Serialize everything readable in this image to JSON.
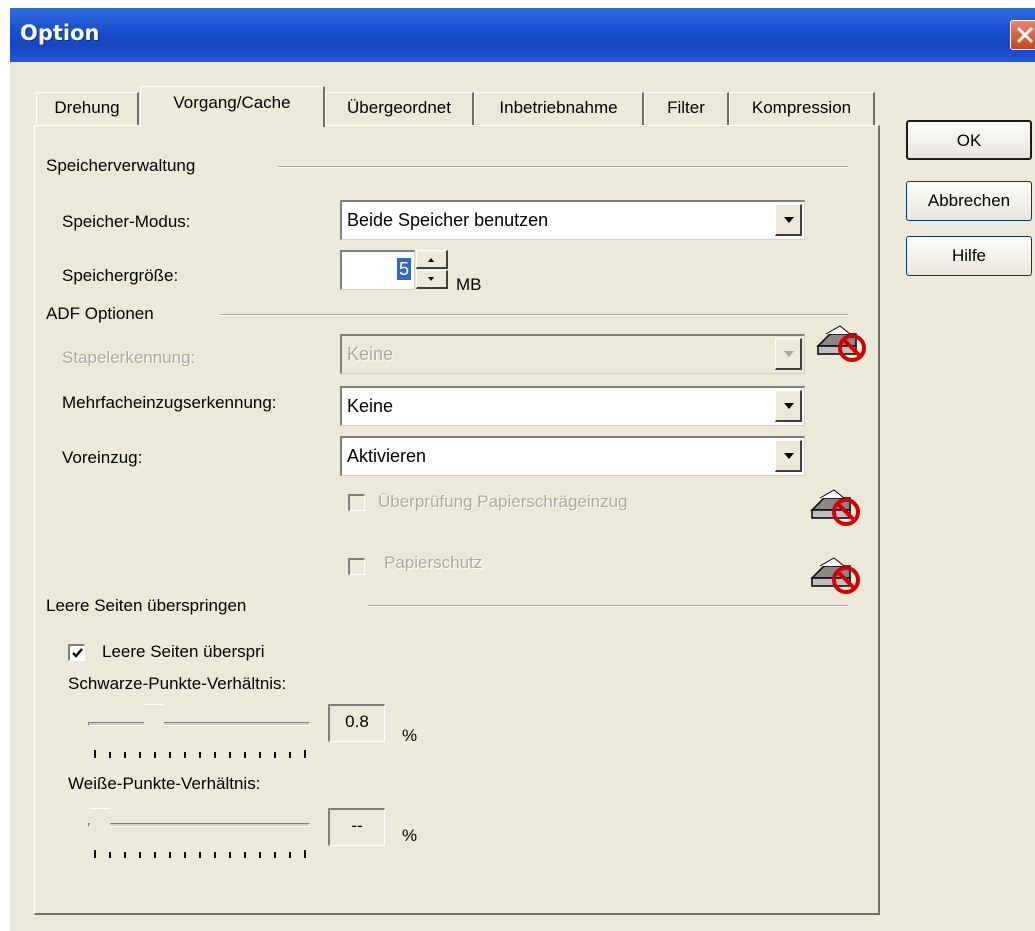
{
  "window": {
    "title": "Option"
  },
  "tabs": [
    {
      "label": "Drehung"
    },
    {
      "label": "Vorgang/Cache"
    },
    {
      "label": "Übergeordnet"
    },
    {
      "label": "Inbetriebnahme"
    },
    {
      "label": "Filter"
    },
    {
      "label": "Kompression"
    }
  ],
  "buttons": {
    "ok": "OK",
    "cancel": "Abbrechen",
    "help": "Hilfe"
  },
  "memory": {
    "section_title": "Speicherverwaltung",
    "mode_label": "Speicher-Modus:",
    "mode_value": "Beide Speicher benutzen",
    "size_label": "Speichergröße:",
    "size_value": "5",
    "size_unit": "MB"
  },
  "adf": {
    "section_title": "ADF Optionen",
    "stacker_label": "Stapelerkennung:",
    "stacker_value": "Keine",
    "multifeed_label": "Mehrfacheinzugserkennung:",
    "multifeed_value": "Keine",
    "prefeed_label": "Voreinzug:",
    "prefeed_value": "Aktivieren",
    "skew_check_label": "Überprüfung Papierschrägeinzug",
    "paper_protection_label": "Papierschutz"
  },
  "blank_pages": {
    "section_title": "Leere Seiten überspringen",
    "skip_checkbox_label": "Leere Seiten überspri",
    "skip_checked": true,
    "black_ratio_label": "Schwarze-Punkte-Verhältnis:",
    "black_ratio_value": "0.8",
    "black_ratio_unit": "%",
    "white_ratio_label": "Weiße-Punkte-Verhältnis:",
    "white_ratio_value": "--",
    "white_ratio_unit": "%"
  },
  "icons": {
    "close": "close-icon",
    "unavailable": "scanner-unavailable-icon"
  },
  "colors": {
    "titlebar": "#1b4fcf",
    "dialog_bg": "#ece9d8",
    "selection": "#316ac5",
    "disabled_text": "#aca899",
    "prohibited_red": "#d40000"
  }
}
